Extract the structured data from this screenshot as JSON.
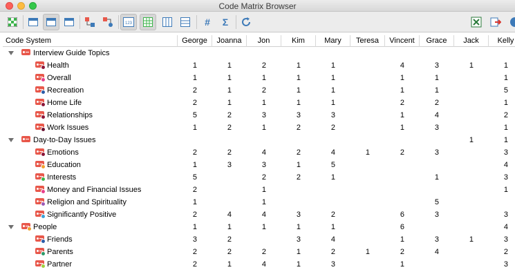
{
  "window": {
    "title": "Code Matrix Browser"
  },
  "table": {
    "first_header": "Code System",
    "columns": [
      "George",
      "Joanna",
      "Jon",
      "Kim",
      "Mary",
      "Teresa",
      "Vincent",
      "Grace",
      "Jack",
      "Kelly"
    ],
    "rows": [
      {
        "label": "Interview Guide Topics",
        "level": 0,
        "expanded": true,
        "dot": "",
        "values": [
          "",
          "",
          "",
          "",
          "",
          "",
          "",
          "",
          "",
          ""
        ]
      },
      {
        "label": "Health",
        "level": 1,
        "dot": "#8b1538",
        "values": [
          "1",
          "1",
          "2",
          "1",
          "1",
          "",
          "4",
          "3",
          "1",
          "1"
        ]
      },
      {
        "label": "Overall",
        "level": 1,
        "dot": "#e83e8c",
        "values": [
          "1",
          "1",
          "1",
          "1",
          "1",
          "",
          "1",
          "1",
          "",
          "1"
        ]
      },
      {
        "label": "Recreation",
        "level": 1,
        "dot": "#2b5ca8",
        "values": [
          "2",
          "1",
          "2",
          "1",
          "1",
          "",
          "1",
          "1",
          "",
          "5"
        ]
      },
      {
        "label": "Home Life",
        "level": 1,
        "dot": "#8b1538",
        "values": [
          "2",
          "1",
          "1",
          "1",
          "1",
          "",
          "2",
          "2",
          "",
          "1"
        ]
      },
      {
        "label": "Relationships",
        "level": 1,
        "dot": "#8b1538",
        "values": [
          "5",
          "2",
          "3",
          "3",
          "3",
          "",
          "1",
          "4",
          "",
          "2"
        ]
      },
      {
        "label": "Work Issues",
        "level": 1,
        "dot": "#6a1030",
        "values": [
          "1",
          "2",
          "1",
          "2",
          "2",
          "",
          "1",
          "3",
          "",
          "1"
        ]
      },
      {
        "label": "Day-to-Day Issues",
        "level": 0,
        "expanded": true,
        "dot": "",
        "values": [
          "",
          "",
          "",
          "",
          "",
          "",
          "",
          "",
          "1",
          "1"
        ]
      },
      {
        "label": "Emotions",
        "level": 1,
        "dot": "#8b1538",
        "values": [
          "2",
          "2",
          "4",
          "2",
          "4",
          "1",
          "2",
          "3",
          "",
          "3"
        ]
      },
      {
        "label": "Education",
        "level": 1,
        "dot": "#f0a030",
        "values": [
          "1",
          "3",
          "3",
          "1",
          "5",
          "",
          "",
          "",
          "",
          "4"
        ]
      },
      {
        "label": "Interests",
        "level": 1,
        "dot": "#3cb44b",
        "values": [
          "5",
          "",
          "2",
          "2",
          "1",
          "",
          "",
          "1",
          "",
          "3"
        ]
      },
      {
        "label": "Money and Financial Issues",
        "level": 1,
        "dot": "#e83e8c",
        "values": [
          "2",
          "",
          "1",
          "",
          "",
          "",
          "",
          "",
          "",
          "1"
        ]
      },
      {
        "label": "Religion and Spirituality",
        "level": 1,
        "dot": "#9b59b6",
        "values": [
          "1",
          "",
          "1",
          "",
          "",
          "",
          "",
          "5",
          "",
          ""
        ]
      },
      {
        "label": "Significantly Positive",
        "level": 1,
        "dot": "#3aa0d8",
        "values": [
          "2",
          "4",
          "4",
          "3",
          "2",
          "",
          "6",
          "3",
          "",
          "3"
        ]
      },
      {
        "label": "People",
        "level": 0,
        "expanded": true,
        "dot": "#f0a030",
        "values": [
          "1",
          "1",
          "1",
          "1",
          "1",
          "",
          "6",
          "",
          "",
          "4"
        ]
      },
      {
        "label": "Friends",
        "level": 1,
        "dot": "#2b5ca8",
        "values": [
          "3",
          "2",
          "",
          "3",
          "4",
          "",
          "1",
          "3",
          "1",
          "3"
        ]
      },
      {
        "label": "Parents",
        "level": 1,
        "dot": "#2a9a6a",
        "values": [
          "2",
          "2",
          "2",
          "1",
          "2",
          "1",
          "2",
          "4",
          "",
          "2"
        ]
      },
      {
        "label": "Partner",
        "level": 1,
        "dot": "#a0d040",
        "values": [
          "2",
          "1",
          "4",
          "1",
          "3",
          "",
          "1",
          "",
          "",
          "3"
        ]
      }
    ]
  },
  "toolbar": {
    "buttons": [
      {
        "name": "matrix-options-button",
        "icon": "grid-icon",
        "active": false
      },
      {
        "name": "view-narrow-button",
        "icon": "window-icon",
        "active": false
      },
      {
        "name": "view-middle-button",
        "icon": "window-icon",
        "active": true
      },
      {
        "name": "view-wide-button",
        "icon": "window-icon",
        "active": false
      },
      {
        "name": "codes-hierarchy-button",
        "icon": "code-tree-icon",
        "active": false
      },
      {
        "name": "codes-subcodes-button",
        "icon": "code-node-icon",
        "active": false
      },
      {
        "name": "show-numbers-button",
        "icon": "numbers-icon",
        "active": true
      },
      {
        "name": "show-grid-button",
        "icon": "table-icon",
        "active": true
      },
      {
        "name": "show-columns-button",
        "icon": "columns-icon",
        "active": false
      },
      {
        "name": "show-rows-button",
        "icon": "rows-icon",
        "active": false
      },
      {
        "name": "number-format-button",
        "icon": "hash-icon",
        "active": false
      },
      {
        "name": "sum-button",
        "icon": "sigma-icon",
        "active": false
      },
      {
        "name": "refresh-button",
        "icon": "refresh-icon",
        "active": false
      },
      {
        "name": "export-excel-button",
        "icon": "excel-icon",
        "active": false
      },
      {
        "name": "export-button",
        "icon": "export-icon",
        "active": false
      }
    ]
  }
}
